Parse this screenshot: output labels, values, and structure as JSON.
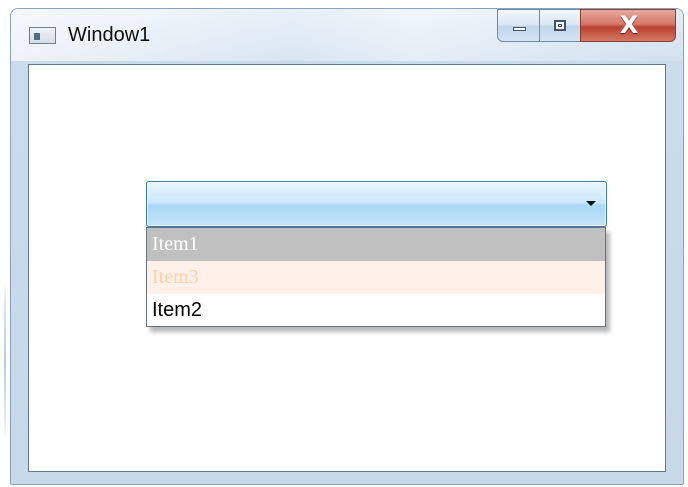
{
  "window": {
    "title": "Window1",
    "caption_buttons": {
      "minimize": "minimize",
      "maximize": "maximize",
      "close_symbol": "X"
    },
    "colors": {
      "frame": "#c7d8e8",
      "close": "#c8503e"
    }
  },
  "combobox": {
    "selected_value": "",
    "colors": {
      "border": "#3d7bad",
      "fill_top": "#e8f5fd",
      "fill_bottom": "#a9d8f5"
    },
    "items": [
      {
        "label": "Item1",
        "background": "#c0c0c0",
        "text_color": "#ffffff"
      },
      {
        "label": "Item3",
        "background": "#fff1e9",
        "text_color": "#ffd0a8"
      },
      {
        "label": "Item2",
        "background": "#ffffff",
        "text_color": "#000000"
      }
    ]
  },
  "icons": {
    "app": "window-app-icon",
    "minimize": "minimize-icon",
    "maximize": "maximize-icon",
    "close": "close-icon",
    "dropdown": "chevron-down-icon"
  }
}
